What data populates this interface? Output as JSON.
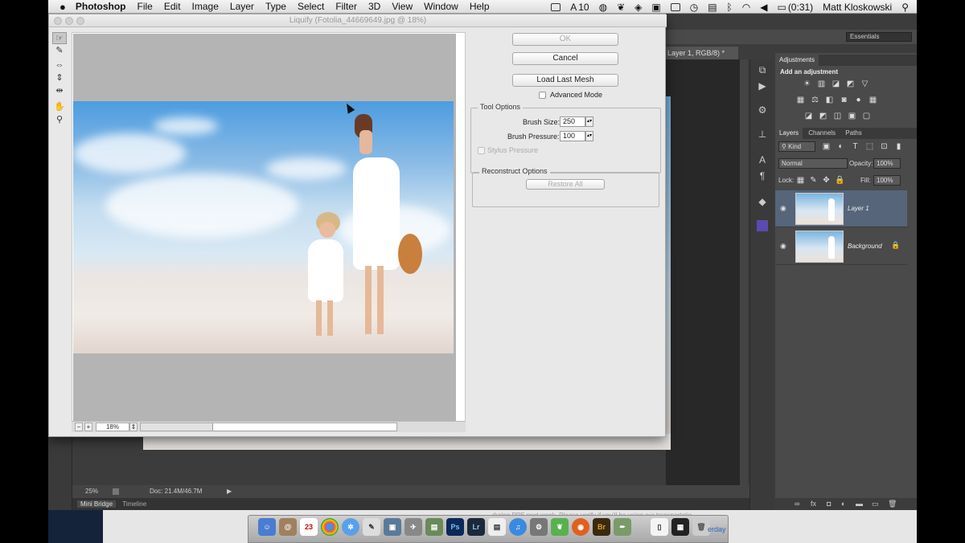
{
  "menubar": {
    "apple": "",
    "app_name": "Photoshop",
    "items": [
      "File",
      "Edit",
      "Image",
      "Layer",
      "Type",
      "Select",
      "Filter",
      "3D",
      "View",
      "Window",
      "Help"
    ],
    "status_adobe_count": "10",
    "battery": "(0:31)",
    "user": "Matt Kloskowski"
  },
  "photoshop": {
    "workspace": "Essentials",
    "doc_tab": "Layer 1, RGB/8) *",
    "status_zoom": "25%",
    "status_doc": "Doc: 21.4M/46.7M",
    "bottom_tabs": [
      "Mini Bridge",
      "Timeline"
    ]
  },
  "liquify": {
    "title": "Liquify (Fotolia_44669649.jpg @ 18%)",
    "ok_label": "OK",
    "cancel_label": "Cancel",
    "load_mesh_label": "Load Last Mesh",
    "advanced_mode_label": "Advanced Mode",
    "tool_options_title": "Tool Options",
    "brush_size_label": "Brush Size:",
    "brush_size_value": "250",
    "brush_pressure_label": "Brush Pressure:",
    "brush_pressure_value": "100",
    "stylus_pressure_label": "Stylus Pressure",
    "reconstruct_title": "Reconstruct Options",
    "restore_all_label": "Restore All",
    "zoom_value": "18%"
  },
  "panels": {
    "adjustments_tab": "Adjustments",
    "add_adjustment_label": "Add an adjustment",
    "layer_tabs": [
      "Layers",
      "Channels",
      "Paths"
    ],
    "kind_label": "Kind",
    "blend_mode": "Normal",
    "opacity_label": "Opacity:",
    "opacity_value": "100%",
    "lock_label": "Lock:",
    "fill_label": "Fill:",
    "fill_value": "100%",
    "layers": [
      {
        "name": "Layer 1",
        "selected": true
      },
      {
        "name": "Background",
        "selected": false
      }
    ]
  },
  "dock": {
    "notice": "during PPE next week. Please verify if you'll be using our transportatio...",
    "yesterday": "erday",
    "calendar_day": "23",
    "icons": [
      "finder-icon",
      "address-book-icon",
      "calendar-icon",
      "chrome-icon",
      "safari-icon",
      "preview-icon",
      "iphoto-icon",
      "migration-icon",
      "app-store-icon",
      "photoshop-icon",
      "lightroom-icon",
      "textedit-icon",
      "itunes-icon",
      "system-prefs-icon",
      "evernote-icon",
      "firefox-icon",
      "bridge-icon",
      "pen-icon",
      "document-icon",
      "terminal-icon",
      "trash-icon"
    ],
    "ps_label": "Ps",
    "lr_label": "Lr",
    "br_label": "Br"
  },
  "colors": {
    "accent_selected_layer": "#56657a",
    "ps_dark_bg": "#3c3c3c",
    "dialog_bg": "#e8e8e8"
  }
}
